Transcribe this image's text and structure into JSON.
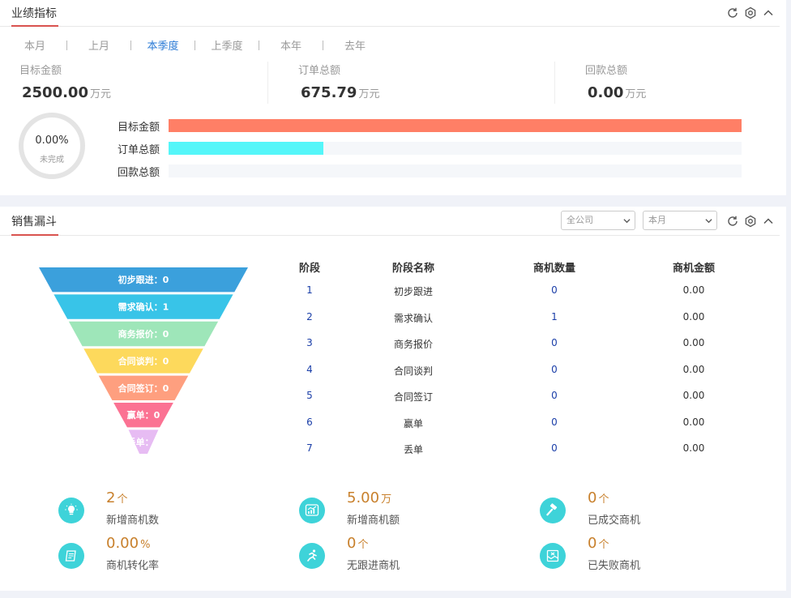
{
  "performance": {
    "title": "业绩指标",
    "tabs": [
      "本月",
      "上月",
      "本季度",
      "上季度",
      "本年",
      "去年"
    ],
    "active_tab": "本季度",
    "metrics": [
      {
        "label": "目标金额",
        "value": "2500.00",
        "unit": "万元"
      },
      {
        "label": "订单总额",
        "value": "675.79",
        "unit": "万元"
      },
      {
        "label": "回款总额",
        "value": "0.00",
        "unit": "万元"
      }
    ],
    "completion": {
      "percent": "0.00%",
      "label": "未完成",
      "fraction": 0
    },
    "bars": [
      {
        "label": "目标金额",
        "fraction": 1.0,
        "color": "#ff7f66"
      },
      {
        "label": "订单总额",
        "fraction": 0.2703,
        "color": "#55f6f9"
      },
      {
        "label": "回款总额",
        "fraction": 0.0,
        "color": "#55f6f9"
      }
    ]
  },
  "funnel": {
    "title": "销售漏斗",
    "scope_select": "全公司",
    "period_select": "本月",
    "stages": [
      {
        "label": "初步跟进：0",
        "color": "#3ba0dc"
      },
      {
        "label": "需求确认：1",
        "color": "#38c4e8"
      },
      {
        "label": "商务报价：0",
        "color": "#9ee6b9"
      },
      {
        "label": "合同谈判：0",
        "color": "#fdd95c"
      },
      {
        "label": "合同签订：0",
        "color": "#fe9f7f"
      },
      {
        "label": "赢单：0",
        "color": "#fb7293"
      },
      {
        "label": "丢单：0",
        "color": "#e7bcf3"
      }
    ],
    "table": {
      "headers": [
        "阶段",
        "阶段名称",
        "商机数量",
        "商机金额"
      ],
      "rows": [
        [
          "1",
          "初步跟进",
          "0",
          "0.00"
        ],
        [
          "2",
          "需求确认",
          "1",
          "0.00"
        ],
        [
          "3",
          "商务报价",
          "0",
          "0.00"
        ],
        [
          "4",
          "合同谈判",
          "0",
          "0.00"
        ],
        [
          "5",
          "合同签订",
          "0",
          "0.00"
        ],
        [
          "6",
          "赢单",
          "0",
          "0.00"
        ],
        [
          "7",
          "丢单",
          "0",
          "0.00"
        ]
      ]
    }
  },
  "stats": [
    {
      "value": "2",
      "unit": "个",
      "label": "新增商机数",
      "icon": "lightbulb-icon"
    },
    {
      "value": "5.00",
      "unit": "万",
      "label": "新增商机额",
      "icon": "growth-chart-icon"
    },
    {
      "value": "0",
      "unit": "个",
      "label": "已成交商机",
      "icon": "gavel-icon"
    },
    {
      "value": "0.00",
      "unit": "%",
      "label": "商机转化率",
      "icon": "scroll-icon"
    },
    {
      "value": "0",
      "unit": "个",
      "label": "无跟进商机",
      "icon": "runner-icon"
    },
    {
      "value": "0",
      "unit": "个",
      "label": "已失败商机",
      "icon": "failed-box-icon"
    }
  ]
}
